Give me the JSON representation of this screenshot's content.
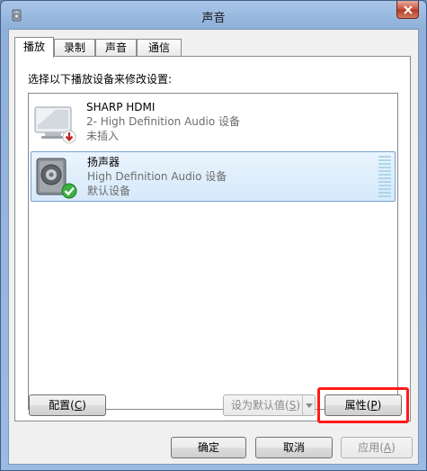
{
  "window": {
    "title": "声音",
    "icon": "speaker-settings-icon",
    "close_icon": "close-icon"
  },
  "tabs": [
    {
      "label": "播放",
      "active": true
    },
    {
      "label": "录制",
      "active": false
    },
    {
      "label": "声音",
      "active": false
    },
    {
      "label": "通信",
      "active": false
    }
  ],
  "instruction": "选择以下播放设备来修改设置:",
  "devices": [
    {
      "name": "SHARP HDMI",
      "description": "2- High Definition Audio 设备",
      "status": "未插入",
      "icon": "monitor-icon",
      "badge": "red-down-arrow-icon",
      "selected": false
    },
    {
      "name": "扬声器",
      "description": "High Definition Audio 设备",
      "status": "默认设备",
      "icon": "speaker-icon",
      "badge": "green-check-icon",
      "selected": true
    }
  ],
  "buttons": {
    "configure": {
      "label": "配置",
      "accel": "C"
    },
    "set_default": {
      "label": "设为默认值",
      "accel": "S"
    },
    "properties": {
      "label": "属性",
      "accel": "P"
    },
    "ok": {
      "label": "确定"
    },
    "cancel": {
      "label": "取消"
    },
    "apply": {
      "label": "应用",
      "accel": "A"
    }
  },
  "colors": {
    "highlight": "#ff1a1a",
    "selection": "#d6e9fb"
  }
}
